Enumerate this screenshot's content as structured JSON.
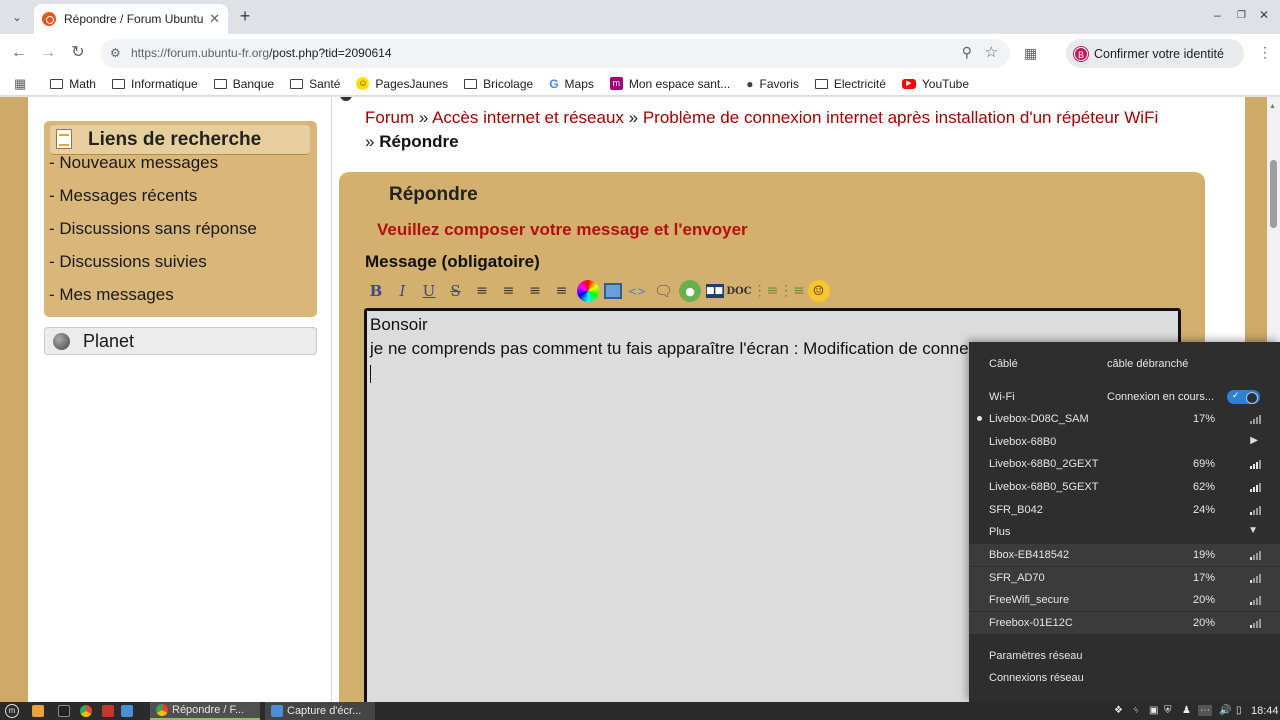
{
  "browser": {
    "tab_title": "Répondre / Forum Ubuntu-fr",
    "url_host": "https://forum.ubuntu-fr.org",
    "url_path": "/post.php?tid=2090614",
    "profile_label": "Confirmer votre identité",
    "profile_initial": "B"
  },
  "bookmarks": [
    {
      "label": "Math",
      "icon": "folder-icon"
    },
    {
      "label": "Informatique",
      "icon": "folder-icon"
    },
    {
      "label": "Banque",
      "icon": "folder-icon"
    },
    {
      "label": "Santé",
      "icon": "folder-icon"
    },
    {
      "label": "PagesJaunes",
      "icon": "pagesjaunes-icon"
    },
    {
      "label": "Bricolage",
      "icon": "folder-icon"
    },
    {
      "label": "Maps",
      "icon": "google-icon"
    },
    {
      "label": "Mon espace sant...",
      "icon": "sante-icon"
    },
    {
      "label": "Favoris",
      "icon": "globe-icon"
    },
    {
      "label": "Electricité",
      "icon": "folder-icon"
    },
    {
      "label": "YouTube",
      "icon": "youtube-icon"
    }
  ],
  "sidebar": {
    "search_title": "Liens de recherche",
    "links": [
      "- Nouveaux messages",
      "- Messages récents",
      "- Discussions sans réponse",
      "- Discussions suivies",
      "- Mes messages"
    ],
    "planet_label": "Planet"
  },
  "breadcrumb": {
    "forum": "Forum",
    "sep1": " » ",
    "category": "Accès internet et réseaux",
    "sep2": " » ",
    "topic": "Problème de connexion internet après installation d'un répéteur WiFi",
    "sep3": "» ",
    "current": "Répondre"
  },
  "post": {
    "heading": "Répondre",
    "instruction": "Veuillez composer votre message et l'envoyer",
    "message_label": "Message (obligatoire)",
    "line1": "Bonsoir",
    "line2": "je ne comprends pas comment tu fais apparaître l'écran : Modification de connex"
  },
  "toolbar_tools": [
    "bold-icon",
    "italic-icon",
    "underline-icon",
    "strike-icon",
    "align-left-icon",
    "align-right-icon",
    "align-center-icon",
    "justify-icon",
    "color-icon",
    "image-icon",
    "code-icon",
    "quote-icon",
    "link-icon",
    "video-icon",
    "doc-icon",
    "bullet-list-icon",
    "numbered-list-icon",
    "smiley-icon"
  ],
  "network": {
    "wired_label": "Câblé",
    "wired_status": "câble débranché",
    "wifi_label": "Wi-Fi",
    "wifi_status": "Connexion en cours...",
    "wifi_enabled": true,
    "networks": [
      {
        "name": "Livebox-D08C_SAM",
        "strength": "17%",
        "connecting": true
      },
      {
        "name": "Livebox-68B0",
        "strength": "",
        "submenu": true
      },
      {
        "name": "Livebox-68B0_2GEXT",
        "strength": "69%"
      },
      {
        "name": "Livebox-68B0_5GEXT",
        "strength": "62%"
      },
      {
        "name": "SFR_B042",
        "strength": "24%"
      }
    ],
    "more_label": "Plus",
    "more_networks": [
      {
        "name": "Bbox-EB418542",
        "strength": "19%"
      },
      {
        "name": "SFR_AD70",
        "strength": "17%"
      },
      {
        "name": "FreeWifi_secure",
        "strength": "20%"
      },
      {
        "name": "Freebox-01E12C",
        "strength": "20%"
      }
    ],
    "settings_label": "Paramètres réseau",
    "connections_label": "Connexions réseau"
  },
  "taskbar": {
    "windows": [
      "Répondre / F...",
      "Capture d'écr..."
    ],
    "clock": "18:44"
  }
}
